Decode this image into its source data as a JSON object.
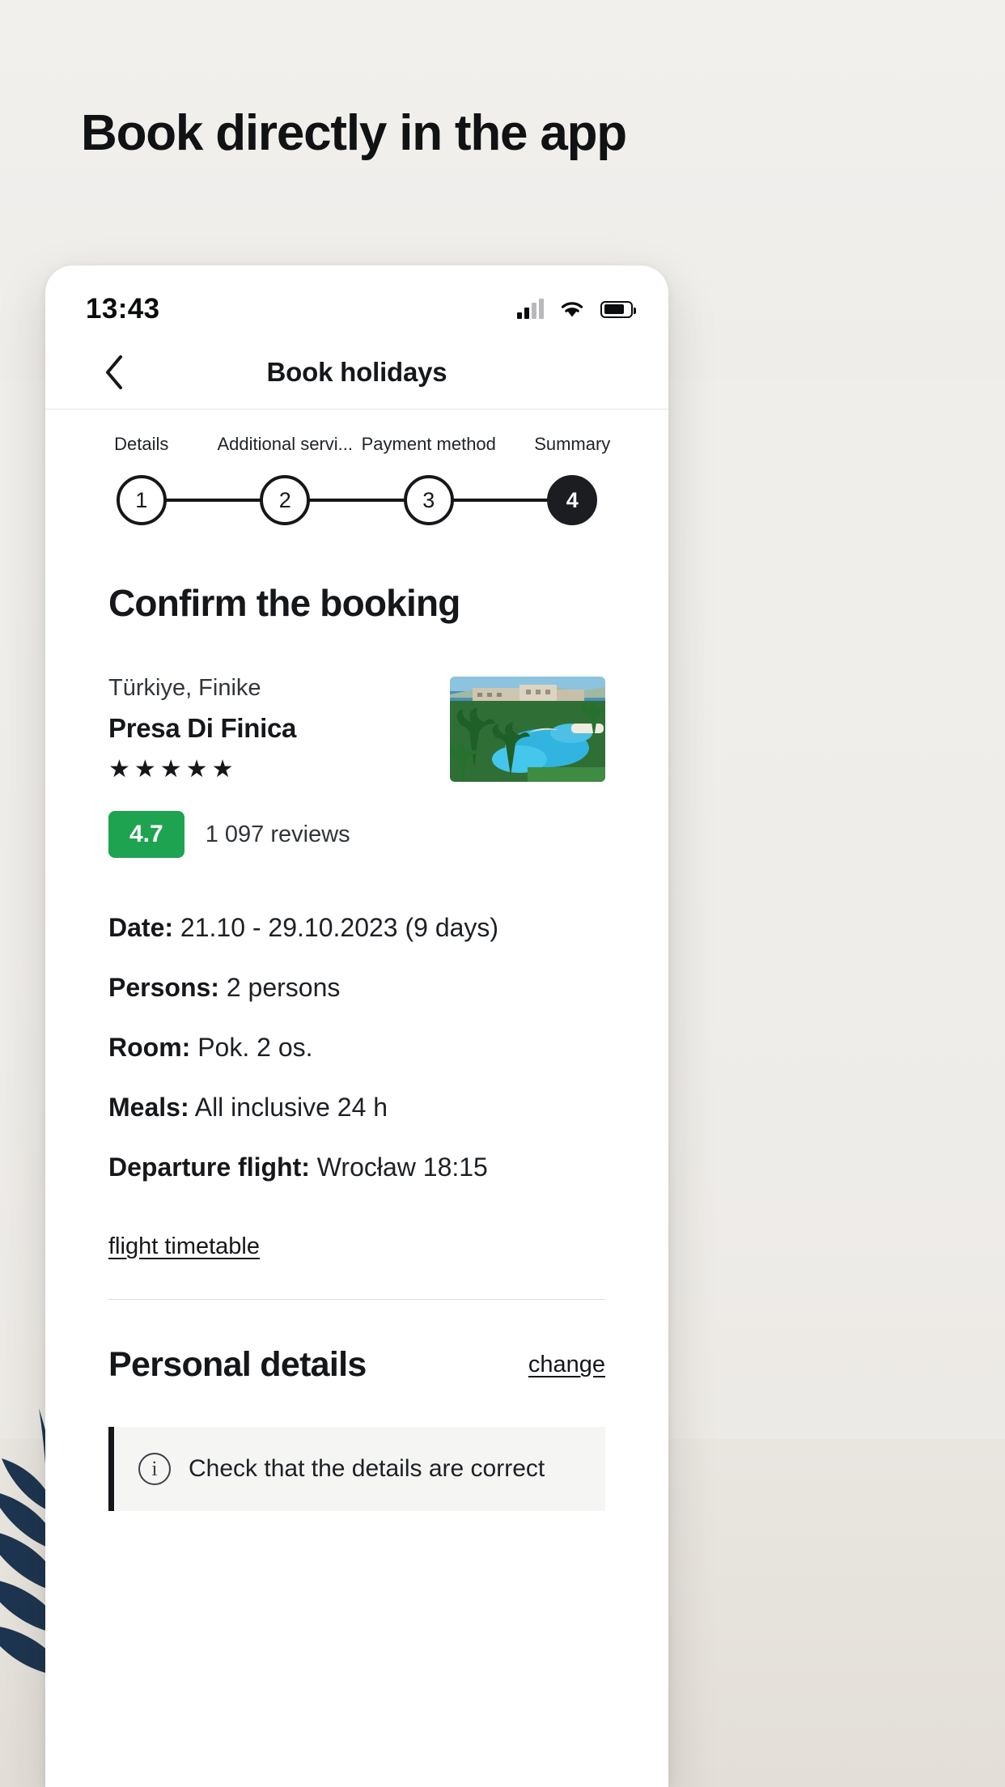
{
  "promo": {
    "title": "Book directly in the app"
  },
  "status_bar": {
    "time": "13:43",
    "signal_icon": "cellular-bars-icon",
    "wifi_icon": "wifi-icon",
    "battery_icon": "battery-icon"
  },
  "nav": {
    "back_icon": "chevron-left-icon",
    "title": "Book holidays"
  },
  "stepper": {
    "steps": [
      {
        "number": "1",
        "label": "Details",
        "active": false
      },
      {
        "number": "2",
        "label": "Additional servi...",
        "active": false
      },
      {
        "number": "3",
        "label": "Payment method",
        "active": false
      },
      {
        "number": "4",
        "label": "Summary",
        "active": true
      }
    ]
  },
  "confirm": {
    "heading": "Confirm the booking"
  },
  "hotel": {
    "country": "Türkiye, Finike",
    "name": "Presa Di Finica",
    "stars": "★★★★★",
    "rating": "4.7",
    "rating_color": "#1ea351",
    "reviews": "1 097 reviews",
    "thumbnail_name": "hotel-photo"
  },
  "details": [
    {
      "label": "Date:",
      "value": "21.10 - 29.10.2023 (9 days)"
    },
    {
      "label": "Persons:",
      "value": "2 persons"
    },
    {
      "label": "Room:",
      "value": "Pok. 2 os."
    },
    {
      "label": "Meals:",
      "value": "All inclusive 24 h"
    },
    {
      "label": "Departure flight:",
      "value": "Wrocław 18:15"
    }
  ],
  "timetable_link": "flight timetable",
  "personal": {
    "title": "Personal details",
    "change_label": "change",
    "note_icon": "info-icon",
    "note_text": "Check that the details are correct"
  }
}
